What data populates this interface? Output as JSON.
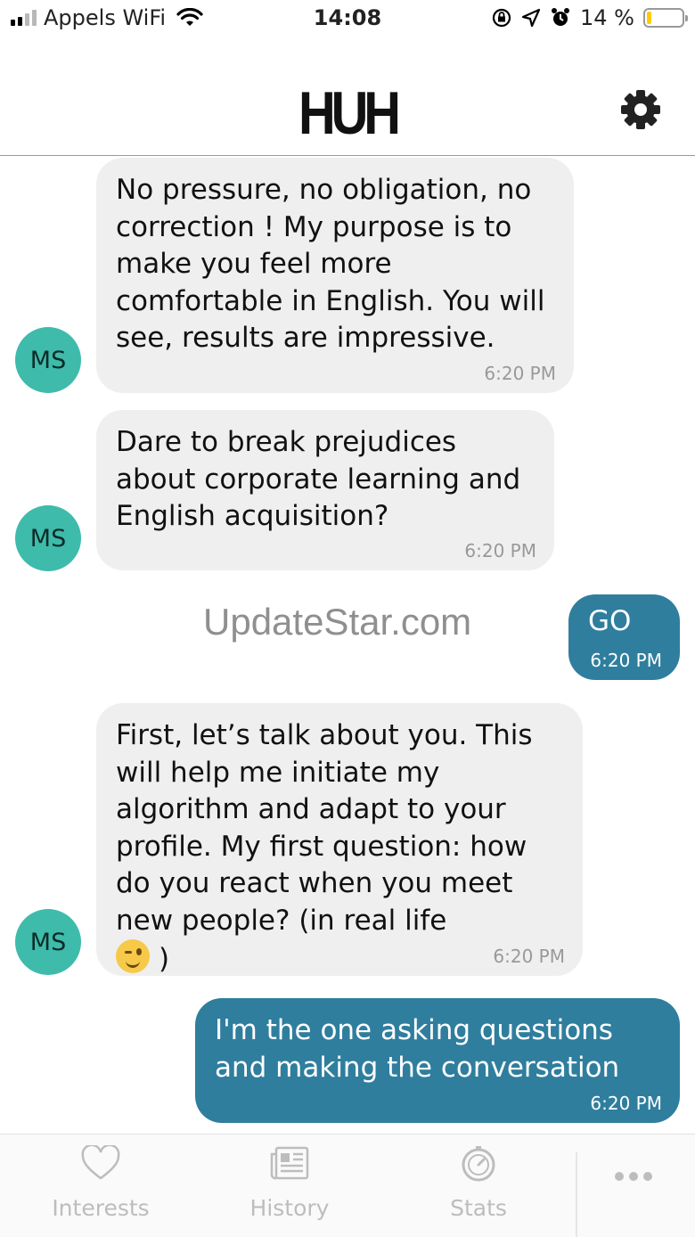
{
  "status_bar": {
    "carrier": "Appels WiFi",
    "time": "14:08",
    "battery_percent": "14 %",
    "battery_level": 0.14,
    "battery_color": "#ffcc00"
  },
  "header": {
    "logo": "HUH",
    "settings_icon": "gear-icon"
  },
  "watermark": "UpdateStar.com",
  "messages": [
    {
      "sender": "bot",
      "avatar": "MS",
      "text": "No pressure, no obligation, no correction ! My purpose is to make you feel more comfortable in English. You will see, results are impressive.",
      "time": "6:20 PM"
    },
    {
      "sender": "bot",
      "avatar": "MS",
      "text": "Dare to break prejudices about corporate learning and English acquisition?",
      "time": "6:20 PM"
    },
    {
      "sender": "user",
      "text": "GO",
      "time": "6:20 PM"
    },
    {
      "sender": "bot",
      "avatar": "MS",
      "text": "First, let’s talk about you. This will help me initiate my algorithm and adapt to your profile. My first question: how do you react when you meet new people? (in real life",
      "text_end": ")",
      "emoji": "winking-face-emoji",
      "time": "6:20 PM"
    },
    {
      "sender": "user",
      "text": "I'm the one asking questions and making the conversation",
      "time": "6:20 PM"
    }
  ],
  "tabs": [
    {
      "label": "Interests",
      "icon": "heart-icon"
    },
    {
      "label": "History",
      "icon": "newspaper-icon"
    },
    {
      "label": "Stats",
      "icon": "stopwatch-icon"
    },
    {
      "label": "",
      "icon": "more-dots-icon"
    }
  ],
  "colors": {
    "bot_bubble": "#efefef",
    "user_bubble": "#2f7e9e",
    "avatar": "#3ebbab",
    "tab_inactive": "#bdbdbd"
  }
}
